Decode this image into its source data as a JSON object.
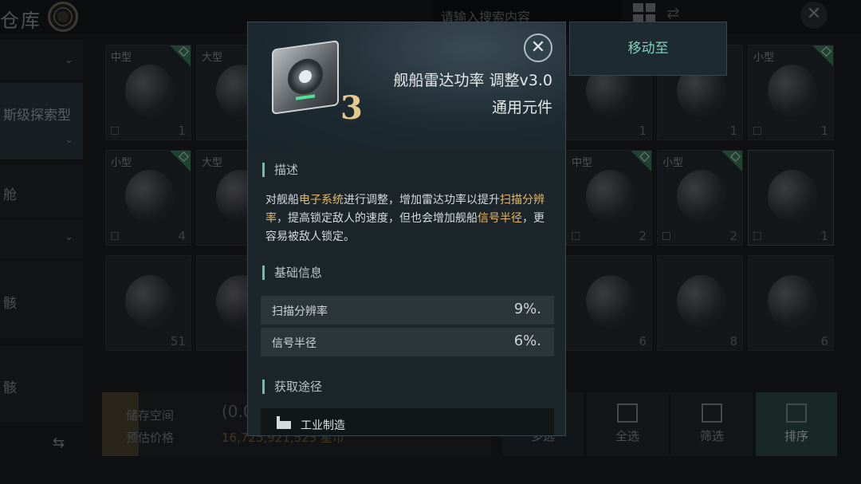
{
  "header": {
    "title": "仓库",
    "search_placeholder": "请输入搜索内容"
  },
  "sidebar": {
    "items": [
      {
        "label": ""
      },
      {
        "label": "斯级探索型"
      },
      {
        "label": "舱"
      },
      {
        "label": ""
      },
      {
        "label": "骸"
      },
      {
        "label": "骸"
      }
    ]
  },
  "grid": {
    "tiles": [
      {
        "size": "中型",
        "count": "1"
      },
      {
        "size": "大型",
        "count": ""
      },
      {
        "size": "",
        "count": "1"
      },
      {
        "size": "",
        "count": "1"
      },
      {
        "size": "小型",
        "count": "1"
      },
      {
        "size": "小型",
        "count": "4"
      },
      {
        "size": "大型",
        "count": ""
      },
      {
        "size": "中型",
        "count": "2"
      },
      {
        "size": "小型",
        "count": "2"
      },
      {
        "size": "",
        "count": "1"
      },
      {
        "size": "",
        "count": "51"
      },
      {
        "size": "",
        "count": ""
      },
      {
        "size": "",
        "count": "6"
      },
      {
        "size": "",
        "count": "8"
      },
      {
        "size": "",
        "count": "6"
      }
    ]
  },
  "bottom": {
    "storage_label": "储存空间",
    "price_label": "预估价格",
    "storage_value": "(0.0",
    "price_value": "16,725,921,525 星币"
  },
  "actions": {
    "multi": "多选",
    "select_all": "全选",
    "filter": "筛选",
    "sort": "排序"
  },
  "move_to": "移动至",
  "modal": {
    "item_level": "3",
    "item_name": "舰船雷达功率 调整v3.0",
    "item_type": "通用元件",
    "desc_title": "描述",
    "desc_parts": {
      "p1": "对舰船",
      "h1": "电子系统",
      "p2": "进行调整，增加雷达功率以提升",
      "h2": "扫描分辨率",
      "p3": "，提高锁定敌人的速度，但也会增加舰船",
      "h3": "信号半径",
      "p4": "，更容易被敌人锁定。"
    },
    "basic_title": "基础信息",
    "stats": [
      {
        "key": "扫描分辨率",
        "value": "9%."
      },
      {
        "key": "信号半径",
        "value": "6%."
      }
    ],
    "source_title": "获取途径",
    "source_item": "工业制造"
  },
  "colors": {
    "accent": "#62c4ad",
    "highlight": "#e7b867",
    "level": "#e4c98f"
  }
}
